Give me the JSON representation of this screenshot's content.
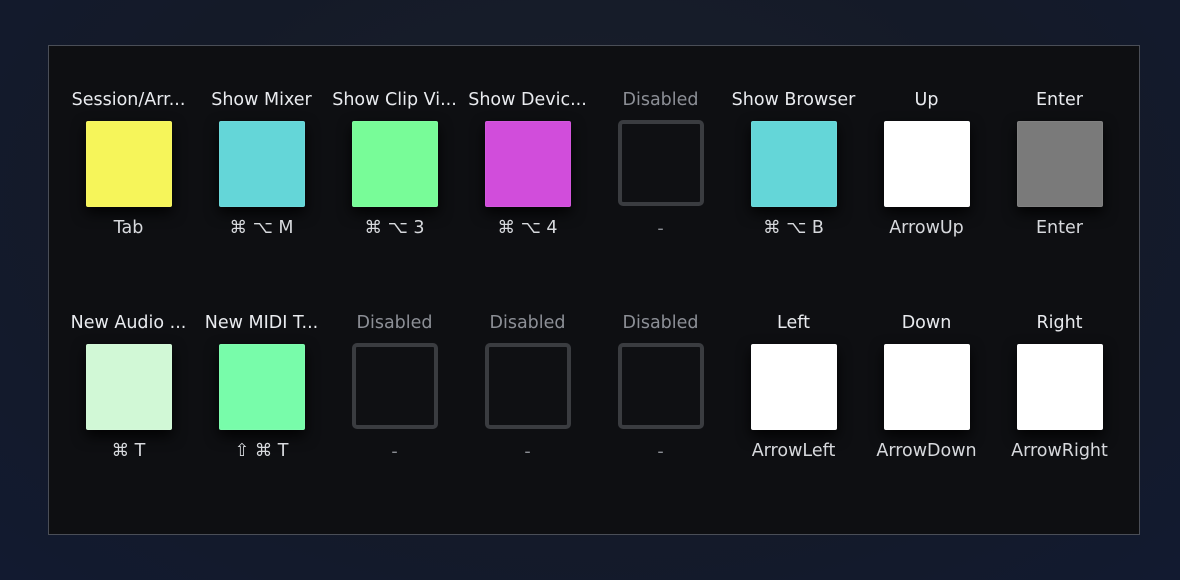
{
  "pads": {
    "row1": [
      {
        "name": "Session/Arr...",
        "color": "#f6f55a",
        "shortcut": "Tab",
        "enabled": true
      },
      {
        "name": "Show Mixer",
        "color": "#64d6d8",
        "shortcut": "⌘ ⌥ M",
        "enabled": true
      },
      {
        "name": "Show Clip Vi...",
        "color": "#78fc98",
        "shortcut": "⌘ ⌥ 3",
        "enabled": true
      },
      {
        "name": "Show Devic...",
        "color": "#d14ddb",
        "shortcut": "⌘ ⌥ 4",
        "enabled": true
      },
      {
        "name": "Disabled",
        "color": "",
        "shortcut": "-",
        "enabled": false
      },
      {
        "name": "Show Browser",
        "color": "#64d6d8",
        "shortcut": "⌘ ⌥ B",
        "enabled": true
      },
      {
        "name": "Up",
        "color": "#ffffff",
        "shortcut": "ArrowUp",
        "enabled": true
      },
      {
        "name": "Enter",
        "color": "#7a7a7a",
        "shortcut": "Enter",
        "enabled": true
      }
    ],
    "row2": [
      {
        "name": "New Audio ...",
        "color": "#d1f8d6",
        "shortcut": "⌘ T",
        "enabled": true
      },
      {
        "name": "New MIDI T...",
        "color": "#78fcaa",
        "shortcut": "⇧ ⌘ T",
        "enabled": true
      },
      {
        "name": "Disabled",
        "color": "",
        "shortcut": "-",
        "enabled": false
      },
      {
        "name": "Disabled",
        "color": "",
        "shortcut": "-",
        "enabled": false
      },
      {
        "name": "Disabled",
        "color": "",
        "shortcut": "-",
        "enabled": false
      },
      {
        "name": "Left",
        "color": "#ffffff",
        "shortcut": "ArrowLeft",
        "enabled": true
      },
      {
        "name": "Down",
        "color": "#ffffff",
        "shortcut": "ArrowDown",
        "enabled": true
      },
      {
        "name": "Right",
        "color": "#ffffff",
        "shortcut": "ArrowRight",
        "enabled": true
      }
    ]
  }
}
